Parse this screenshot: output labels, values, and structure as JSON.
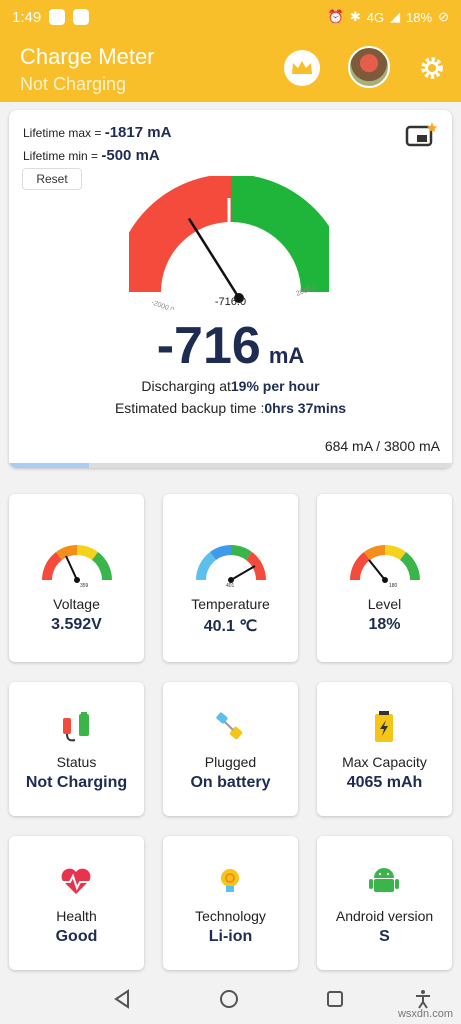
{
  "status_bar": {
    "time": "1:49",
    "battery_text": "18%",
    "network": "4G"
  },
  "app_bar": {
    "title": "Charge Meter",
    "subtitle": "Not Charging"
  },
  "main_card": {
    "lifetime_max_label": "Lifetime max = ",
    "lifetime_max_value": "-1817 mA",
    "lifetime_min_label": "Lifetime min = ",
    "lifetime_min_value": "-500 mA",
    "reset_label": "Reset",
    "gauge": {
      "min_label": "-2000.0",
      "max_label": "2000.0",
      "value_label": "-716.0",
      "value": -716,
      "min": -2000,
      "max": 2000
    },
    "current_value": "-716",
    "current_unit": "mA",
    "discharging_prefix": "Discharging at",
    "discharging_rate": "19% per hour",
    "backup_prefix": "Estimated backup time :",
    "backup_time": "0hrs 37mins",
    "capacity_ratio": "684 mA / 3800 mA",
    "progress_fraction": 0.18
  },
  "tiles": {
    "voltage": {
      "label": "Voltage",
      "value": "3.592V",
      "gauge_label": "359"
    },
    "temperature": {
      "label": "Temperature",
      "value": "40.1 ℃",
      "gauge_label": "401"
    },
    "level": {
      "label": "Level",
      "value": "18%",
      "gauge_label": "180"
    },
    "status": {
      "label": "Status",
      "value": "Not Charging"
    },
    "plugged": {
      "label": "Plugged",
      "value": "On battery"
    },
    "max_capacity": {
      "label": "Max Capacity",
      "value": "4065 mAh"
    },
    "health": {
      "label": "Health",
      "value": "Good"
    },
    "technology": {
      "label": "Technology",
      "value": "Li-ion"
    },
    "android": {
      "label": "Android version",
      "value": "S"
    }
  },
  "watermark": "wsxdn.com",
  "colors": {
    "accent": "#f9bf2a",
    "value_text": "#1e2c52",
    "gauge_red": "#f44b3c",
    "gauge_green": "#1fb43a"
  }
}
